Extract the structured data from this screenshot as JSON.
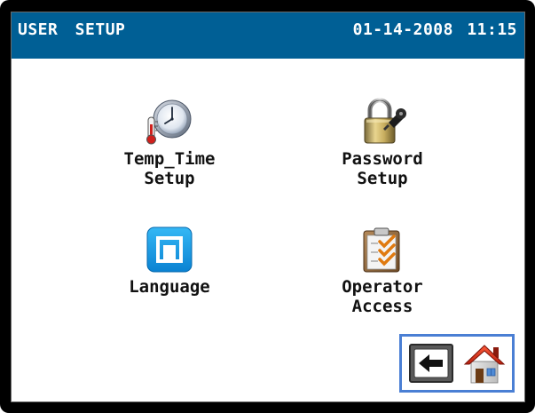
{
  "header": {
    "title": "USER SETUP",
    "datetime": "01-14-2008 11:15",
    "bg_color": "#005f95"
  },
  "menu": {
    "items": [
      {
        "label": "Temp_Time\nSetup",
        "icon": "clock-thermometer-icon"
      },
      {
        "label": "Password\nSetup",
        "icon": "padlock-key-icon"
      },
      {
        "label": "Language",
        "icon": "language-icon"
      },
      {
        "label": "Operator\nAccess",
        "icon": "clipboard-checklist-icon"
      }
    ]
  },
  "nav": {
    "back_icon": "back-arrow-icon",
    "home_icon": "home-icon",
    "highlight_color": "#4a7fd4"
  }
}
